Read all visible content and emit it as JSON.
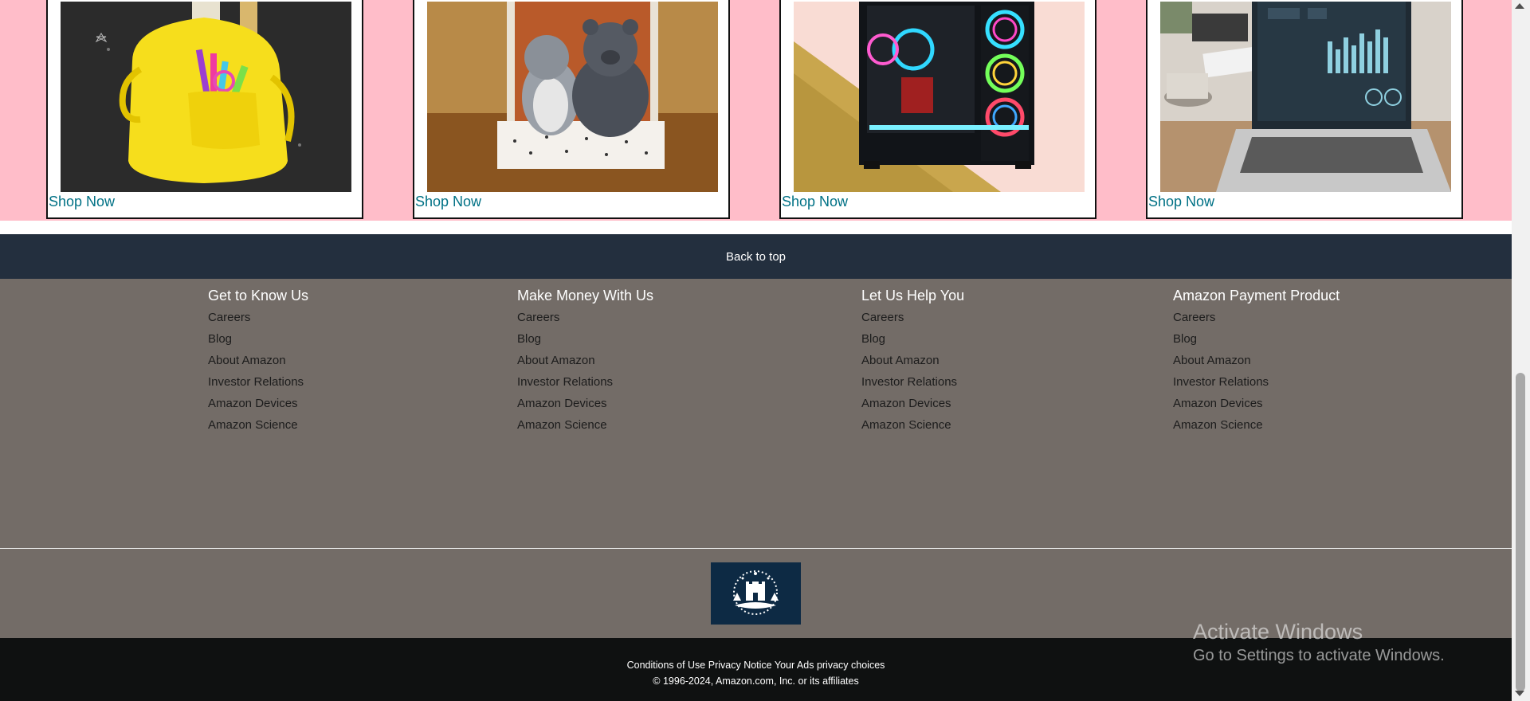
{
  "products": [
    {
      "image": "yellow school backpack with pencils on chalkboard",
      "cta": "Shop Now"
    },
    {
      "image": "plush penguin and bear toys in gift box",
      "cta": "Shop Now"
    },
    {
      "image": "gaming PC tower with RGB fans",
      "cta": "Shop Now"
    },
    {
      "image": "laptop showing analytics dashboard",
      "cta": "Shop Now"
    }
  ],
  "back_to_top": "Back to top",
  "footer": {
    "columns": [
      {
        "heading": "Get to Know Us",
        "links": [
          "Careers",
          "Blog",
          "About Amazon",
          "Investor Relations",
          "Amazon Devices",
          "Amazon Science"
        ]
      },
      {
        "heading": "Make Money With Us",
        "links": [
          "Careers",
          "Blog",
          "About Amazon",
          "Investor Relations",
          "Amazon Devices",
          "Amazon Science"
        ]
      },
      {
        "heading": "Let Us Help You",
        "links": [
          "Careers",
          "Blog",
          "About Amazon",
          "Investor Relations",
          "Amazon Devices",
          "Amazon Science"
        ]
      },
      {
        "heading": "Amazon Payment Product",
        "links": [
          "Careers",
          "Blog",
          "About Amazon",
          "Investor Relations",
          "Amazon Devices",
          "Amazon Science"
        ]
      }
    ]
  },
  "bottom": {
    "links": [
      "Conditions of Use",
      "Privacy Notice",
      "Your Ads privacy choices"
    ],
    "copyright": "© 1996-2024, Amazon.com, Inc. or its affiliates"
  },
  "watermark": {
    "title": "Activate Windows",
    "subtitle": "Go to Settings to activate Windows."
  },
  "colors": {
    "product_bg": "#ffbdc9",
    "back_to_top_bg": "#232f3e",
    "footer_bg": "#736c67",
    "bottom_bg": "#0f1111",
    "link": "#007185"
  }
}
